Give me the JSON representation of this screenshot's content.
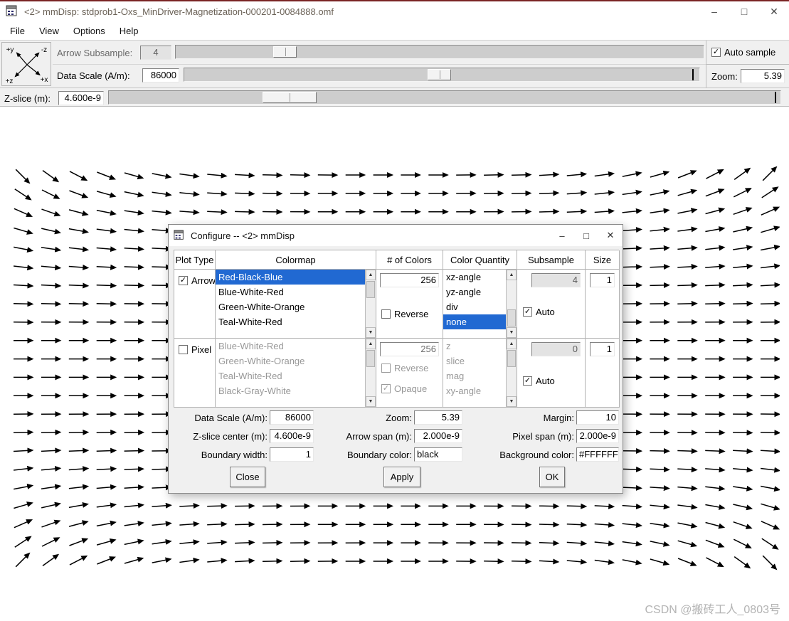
{
  "icons": {
    "minimize": "–",
    "maximize": "□",
    "close": "✕",
    "check": "✓",
    "up": "▲",
    "down": "▼"
  },
  "window": {
    "title": "<2> mmDisp: stdprob1-Oxs_MinDriver-Magnetization-000201-0084888.omf"
  },
  "menu": {
    "items": [
      "File",
      "View",
      "Options",
      "Help"
    ]
  },
  "toolbar": {
    "axes": {
      "y": "+y",
      "neg_z": "-z",
      "z": "+z",
      "x": "+x"
    },
    "arrow_subsample": {
      "label": "Arrow Subsample:",
      "value": "4"
    },
    "auto_sample": {
      "label": "Auto sample",
      "checked": true
    },
    "data_scale": {
      "label": "Data Scale (A/m):",
      "value": "86000"
    },
    "zoom": {
      "label": "Zoom:",
      "value": "5.39"
    },
    "z_slice": {
      "label": "Z-slice (m):",
      "value": "4.600e-9"
    }
  },
  "dialog": {
    "title": "Configure -- <2> mmDisp",
    "headers": [
      "Plot Type",
      "Colormap",
      "# of Colors",
      "Color Quantity",
      "Subsample",
      "Size"
    ],
    "arrow": {
      "label": "Arrow",
      "checked": true,
      "colormap": [
        "Red-Black-Blue",
        "Blue-White-Red",
        "Green-White-Orange",
        "Teal-White-Red"
      ],
      "colormap_selected": "Red-Black-Blue",
      "num_colors": "256",
      "reverse": "Reverse",
      "quantity": [
        "xz-angle",
        "yz-angle",
        "div",
        "none"
      ],
      "quantity_selected": "none",
      "subsample": "4",
      "auto": "Auto",
      "size": "1"
    },
    "pixel": {
      "label": "Pixel",
      "checked": false,
      "colormap": [
        "Blue-White-Red",
        "Green-White-Orange",
        "Teal-White-Red",
        "Black-Gray-White"
      ],
      "num_colors": "256",
      "reverse": "Reverse",
      "opaque": "Opaque",
      "quantity": [
        "z",
        "slice",
        "mag",
        "xy-angle"
      ],
      "subsample": "0",
      "auto": "Auto",
      "size": "1"
    },
    "form": {
      "data_scale": {
        "label": "Data Scale (A/m):",
        "value": "86000"
      },
      "zoom": {
        "label": "Zoom:",
        "value": "5.39"
      },
      "margin": {
        "label": "Margin:",
        "value": "10"
      },
      "z_slice_center": {
        "label": "Z-slice center (m):",
        "value": "4.600e-9"
      },
      "arrow_span": {
        "label": "Arrow span (m):",
        "value": "2.000e-9"
      },
      "pixel_span": {
        "label": "Pixel span (m):",
        "value": "2.000e-9"
      },
      "boundary_width": {
        "label": "Boundary width:",
        "value": "1"
      },
      "boundary_color": {
        "label": "Boundary color:",
        "value": "black"
      },
      "background_color": {
        "label": "Background color:",
        "value": "#FFFFFF"
      }
    },
    "buttons": {
      "close": "Close",
      "apply": "Apply",
      "ok": "OK"
    }
  },
  "field": {
    "rows": 22,
    "cols": 28,
    "tilt_deg": 45,
    "arrow_line": 22,
    "color": "#000000",
    "pattern": "leaf-state"
  },
  "colors": {
    "selection": "#2169d2",
    "accent_top": "#7a2424"
  },
  "watermark": {
    "text": "CSDN @搬砖工人_0803号"
  }
}
